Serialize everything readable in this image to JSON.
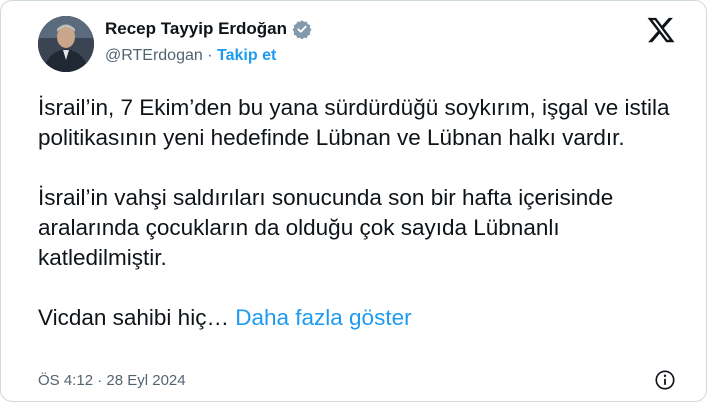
{
  "author": {
    "display_name": "Recep Tayyip Erdoğan",
    "handle": "@RTErdogan",
    "separator": "·",
    "follow_label": "Takip et"
  },
  "icons": {
    "verified": "verified-badge-icon",
    "platform": "x-logo-icon",
    "info": "info-icon"
  },
  "tweet": {
    "paragraph_1": "İsrail’in, 7 Ekim’den bu yana sürdürdüğü soykırım, işgal ve istila politikasının yeni hedefinde Lübnan ve Lübnan halkı vardır.",
    "paragraph_2": "İsrail’in vahşi saldırıları sonucunda son bir hafta içerisinde aralarında çocukların da olduğu çok sayıda Lübnanlı katledilmiştir.",
    "paragraph_3": "Vicdan sahibi hiç…",
    "show_more": "Daha fazla göster"
  },
  "meta": {
    "time": "ÖS 4:12",
    "separator": "·",
    "date": "28 Eyl 2024"
  },
  "colors": {
    "link": "#1d9bf0",
    "secondary_text": "#536471",
    "text": "#0f1419",
    "border": "#cfd9de"
  }
}
